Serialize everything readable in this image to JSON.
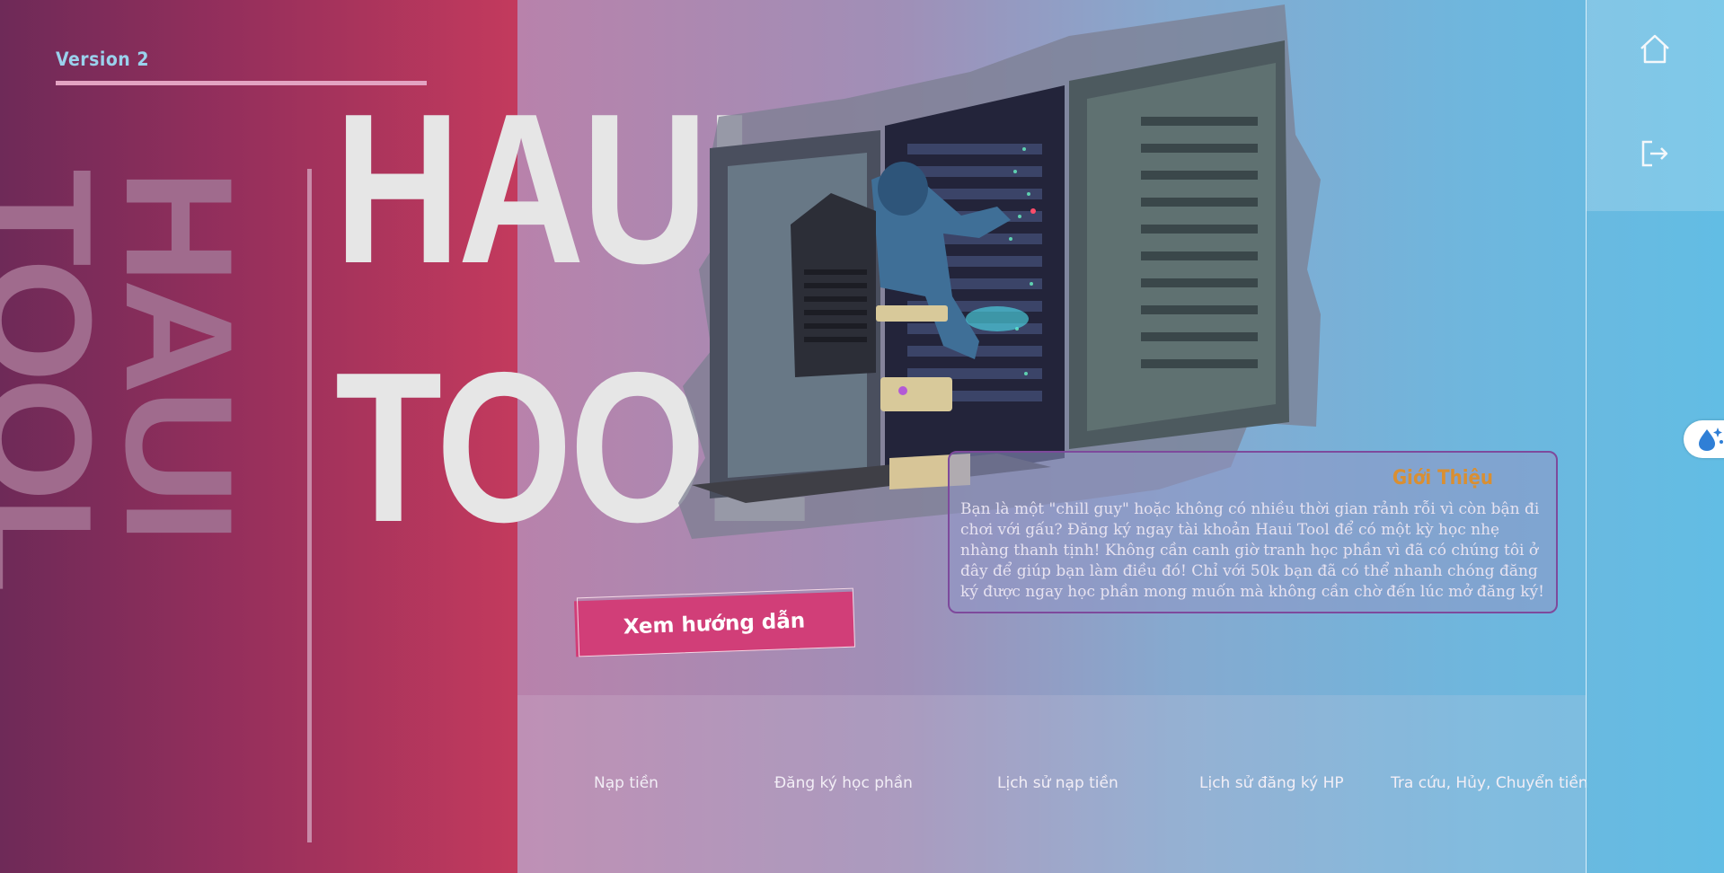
{
  "brand": {
    "version": "Version 2",
    "vertical_word": "HAUI TOOL",
    "title_line1": "HAUI",
    "title_line2": "TOOL"
  },
  "intro": {
    "title": "Giới Thiệu",
    "text": "Bạn là một \"chill guy\" hoặc không có nhiều thời gian rảnh rỗi vì còn bận đi chơi với gấu? Đăng ký ngay tài khoản Haui Tool để có một kỳ học nhẹ nhàng thanh tịnh! Không cần canh giờ tranh học phần vì đã có chúng tôi ở đây để giúp bạn làm điều đó! Chỉ với 50k bạn đã có thể nhanh chóng đăng ký được ngay học phần mong muốn mà không cần chờ đến lúc mở đăng ký!"
  },
  "guide_button": "Xem hướng dẫn",
  "nav": [
    "Nạp tiền",
    "Đăng ký học phần",
    "Lịch sử nạp tiền",
    "Lịch sử đăng ký HP",
    "Tra cứu, Hủy, Chuyển tiền"
  ],
  "icons": {
    "home": "home-icon",
    "logout": "logout-icon",
    "float": "water-drop-sparkle-icon"
  },
  "colors": {
    "left_panel_start": "#6e2a58",
    "left_panel_end": "#c33a5d",
    "guide_button": "#d13e78",
    "intro_title": "#d98f32",
    "card_border": "#7e4a9c",
    "right_bg": "#62bde4"
  }
}
